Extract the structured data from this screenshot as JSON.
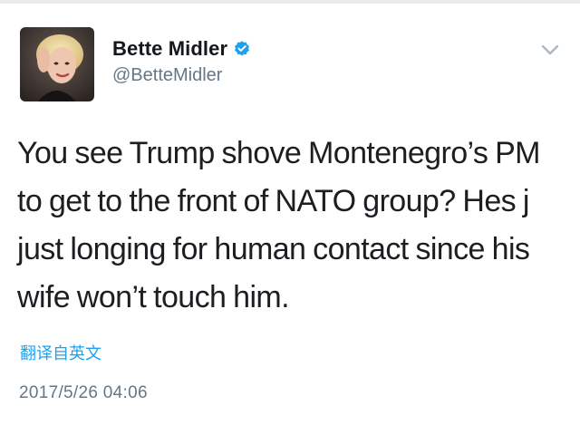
{
  "tweet": {
    "author": {
      "display_name": "Bette Midler",
      "handle": "@BetteMidler",
      "verified": true,
      "avatar_icon": "avatar-photo"
    },
    "text_lines": [
      "You see Trump shove Montenegro’s PM",
      "to get to the front of NATO group? Hes j",
      "just longing for human contact since his",
      "wife won’t touch him."
    ],
    "translate_label": "翻译自英文",
    "timestamp": "2017/5/26 04:06",
    "menu_icon": "chevron-down-icon"
  },
  "colors": {
    "accent": "#1da1f2",
    "verified_badge": "#1da1f2",
    "secondary_text": "#657786",
    "primary_text": "#14171a",
    "divider": "#e9ebee"
  }
}
